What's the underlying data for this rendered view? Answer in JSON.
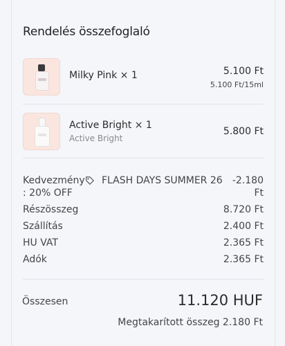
{
  "summary": {
    "title": "Rendelés összefoglaló"
  },
  "items": [
    {
      "name": "Milky Pink × 1",
      "price": "5.100 Ft",
      "unit_price": "5.100 Ft/15ml",
      "thumb_icon": "perfume-bottle-icon"
    },
    {
      "name": "Active Bright × 1",
      "variant": "Active Bright",
      "price": "5.800 Ft",
      "thumb_icon": "perfume-bottle-icon"
    }
  ],
  "discount": {
    "label_line1": "Kedvezmény",
    "label_line2": ": 20% OFF",
    "code": "FLASH DAYS SUMMER 26",
    "amount_line1": "-2.180",
    "amount_line2": "Ft",
    "icon": "tag-icon"
  },
  "totals": {
    "subtotal_label": "Részösszeg",
    "subtotal_value": "8.720 Ft",
    "shipping_label": "Szállítás",
    "shipping_value": "2.400 Ft",
    "vat_label": "HU VAT",
    "vat_value": "2.365 Ft",
    "taxes_label": "Adók",
    "taxes_value": "2.365 Ft",
    "total_label": "Összesen",
    "total_value": "11.120 HUF",
    "savings_text": "Megtakarított összeg 2.180 Ft"
  },
  "colors": {
    "background": "#f4f6fa",
    "thumb_bg": "#fbe6df"
  }
}
